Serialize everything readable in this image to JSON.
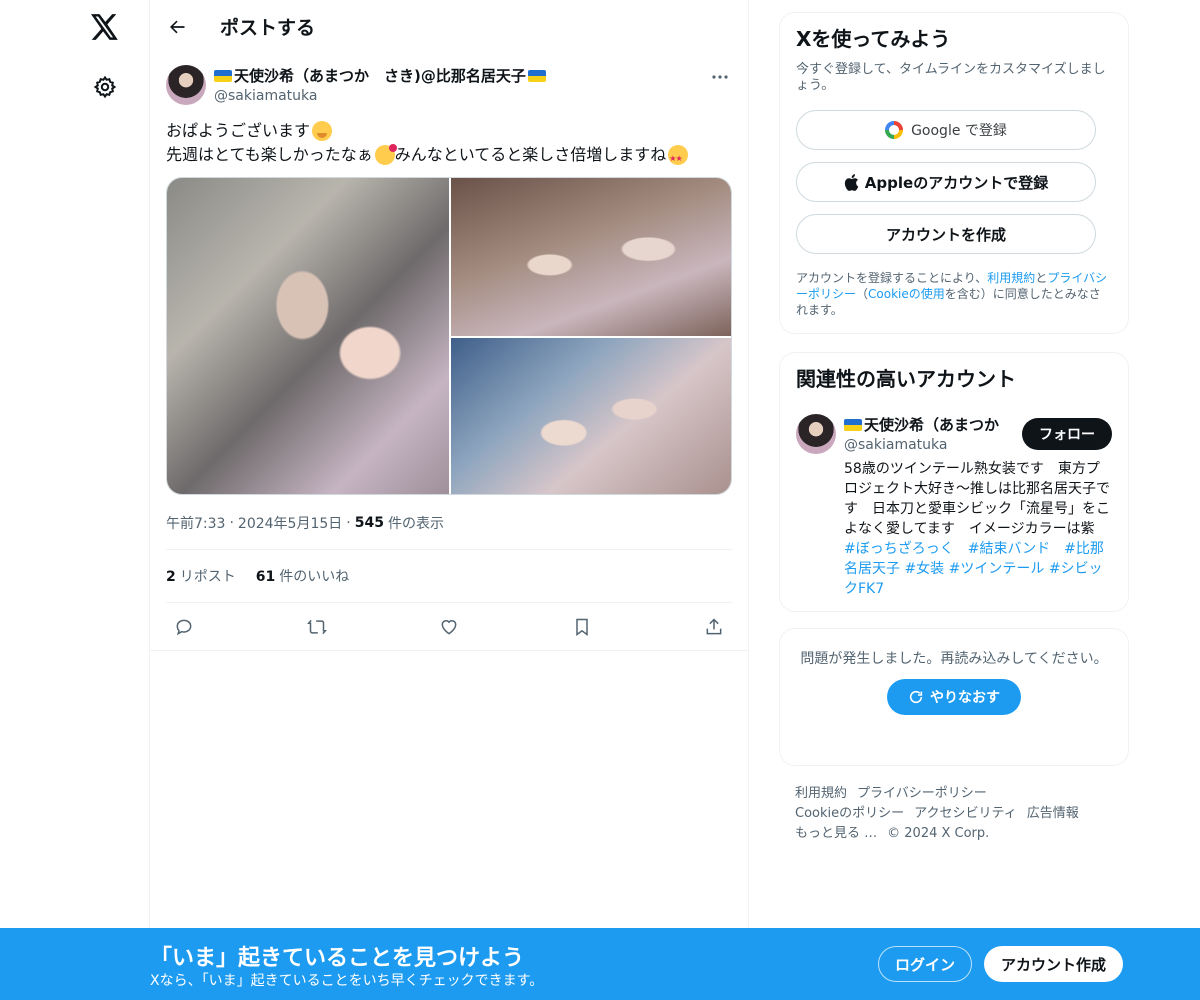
{
  "nav": {
    "logo_icon": "x-logo-icon",
    "settings_icon": "gear-icon"
  },
  "header": {
    "title": "ポストする"
  },
  "post": {
    "author_name": "天使沙希（あまつか　さき)@比那名居天子",
    "author_handle": "@sakiamatuka",
    "text_line1": "おぱようございます",
    "text_line2": "先週はとても楽しかったなぁ",
    "text_line2b": "みんなといてると楽しさ倍増しますね",
    "time": "午前7:33",
    "date": "2024年5月15日",
    "views_count": "545",
    "views_label": "件の表示",
    "reposts_count": "2",
    "reposts_label": "リポスト",
    "likes_count": "61",
    "likes_label": "件のいいね"
  },
  "signup": {
    "title": "Xを使ってみよう",
    "subtitle": "今すぐ登録して、タイムラインをカスタマイズしましょう。",
    "google_label": "Google で登録",
    "apple_label": "Appleのアカウントで登録",
    "create_label": "アカウントを作成",
    "terms_pre": "アカウントを登録することにより、",
    "terms_link1": "利用規約",
    "terms_and": "と",
    "terms_link2": "プライバシーポリシー",
    "terms_mid": "（",
    "terms_link3": "Cookieの使用",
    "terms_post": "を含む）に同意したとみなされます。"
  },
  "related": {
    "title": "関連性の高いアカウント",
    "name": "天使沙希（あまつか",
    "handle": "@sakiamatuka",
    "follow_label": "フォロー",
    "bio_text": "58歳のツインテール熟女装です　東方プロジェクト大好き〜推しは比那名居天子です　日本刀と愛車シビック「流星号」をこよなく愛してます　イメージカラーは紫　",
    "tag1": "#ぼっちざろっく",
    "tag2": "#結束バンド",
    "tag3": "#比那名居天子",
    "tag4": "#女装",
    "tag5": "#ツインテール",
    "tag6": "#シビックFK7"
  },
  "error": {
    "message": "問題が発生しました。再読み込みしてください。",
    "retry_label": "やりなおす"
  },
  "footer": {
    "terms": "利用規約",
    "privacy": "プライバシーポリシー",
    "cookie": "Cookieのポリシー",
    "accessibility": "アクセシビリティ",
    "ads": "広告情報",
    "more": "もっと見る …",
    "copyright": "© 2024 X Corp."
  },
  "banner": {
    "title": "「いま」起きていることを見つけよう",
    "subtitle": "Xなら、「いま」起きていることをいち早くチェックできます。",
    "login_label": "ログイン",
    "signup_label": "アカウント作成"
  },
  "colors": {
    "accent": "#1d9bf0",
    "text": "#0f1419",
    "muted": "#536471",
    "border": "#eff3f4"
  }
}
